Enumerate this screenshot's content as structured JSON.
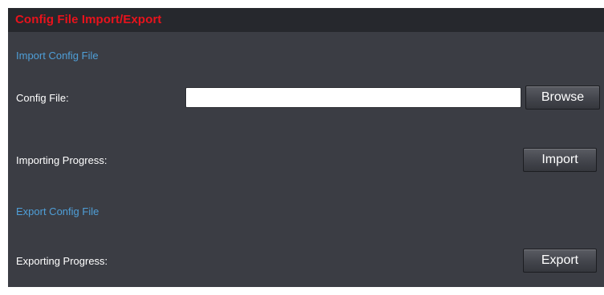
{
  "panel": {
    "title": "Config File Import/Export"
  },
  "import_section": {
    "title": "Import Config File",
    "config_file_label": "Config File:",
    "config_file_value": "",
    "browse_label": "Browse",
    "progress_label": "Importing Progress:",
    "import_label": "Import"
  },
  "export_section": {
    "title": "Export Config File",
    "progress_label": "Exporting Progress:",
    "export_label": "Export"
  },
  "colors": {
    "panel_background": "#3b3d44",
    "header_background": "#26282d",
    "title_red": "#e8131c",
    "section_blue": "#4f9fd8",
    "label_white": "#ffffff"
  }
}
